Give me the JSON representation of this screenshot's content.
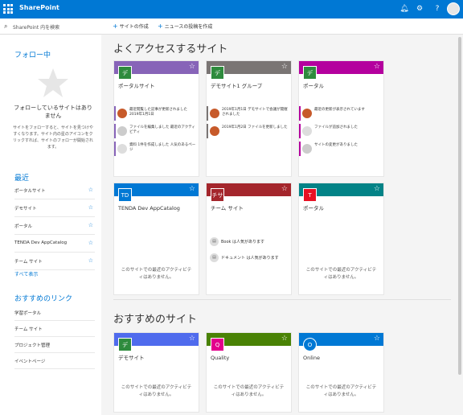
{
  "header": {
    "app_name": "SharePoint",
    "brand_color": "#0078d4",
    "icons": [
      "waffle-icon",
      "bell-icon",
      "gear-icon",
      "help-icon",
      "avatar"
    ]
  },
  "sidebar": {
    "search_placeholder": "SharePoint 内を検索",
    "following_title": "フォロー中",
    "following_message": "フォローしているサイトはありません",
    "following_help": "サイトをフォローすると、サイトを見つけやすくなります。サイト内の星のアイコンをクリックすれば、サイトのフォローが開始されます。",
    "recent_title": "最近",
    "recent_items": [
      {
        "label": "ポータルサイト"
      },
      {
        "label": "デモサイト"
      },
      {
        "label": "ポータル"
      },
      {
        "label": "TENDA Dev AppCatalog"
      },
      {
        "label": "チーム サイト"
      }
    ],
    "show_all": "すべて表示",
    "links_title": "おすすめのリンク",
    "links": [
      {
        "label": "学習ポータル"
      },
      {
        "label": "チーム サイト"
      },
      {
        "label": "プロジェクト管理"
      },
      {
        "label": "イベントページ"
      }
    ]
  },
  "commandbar": {
    "create_site": "サイトの作成",
    "create_news": "ニュースの投稿を作成"
  },
  "frequent": {
    "title": "よくアクセスするサイト",
    "cards": [
      {
        "color": "#8764b8",
        "logo_color": "#2e8b3d",
        "logo": "デ",
        "name": "ポータルサイト",
        "activities": [
          {
            "avatar": "person",
            "text": "最近閲覧した記事が更新されました 2019年1月1日"
          },
          {
            "avatar": "gray",
            "text": "ファイルを編集しました 最近のアクティビティ"
          },
          {
            "avatar": "doc",
            "text": "資料 1件を作成しました 人気のあるページ"
          }
        ]
      },
      {
        "color": "#7a7574",
        "logo_color": "#2e8b3d",
        "logo": "デ",
        "name": "デモサイト1 グループ",
        "activities": [
          {
            "avatar": "person",
            "text": "2019年1月1日 デモサイトで会議が開催されました"
          },
          {
            "avatar": "person",
            "text": "2019年1月2日 ファイルを更新しました"
          }
        ]
      },
      {
        "color": "#b4009e",
        "logo_color": "#2e8b3d",
        "logo": "デ",
        "name": "ポータル",
        "activities": [
          {
            "avatar": "person",
            "text": "最近の更新が表示されています"
          },
          {
            "avatar": "doc",
            "text": "ファイルが追加されました"
          },
          {
            "avatar": "gray",
            "text": "サイトの変更がありました"
          }
        ]
      },
      {
        "color": "#0078d4",
        "logo_color": "#0078d4",
        "logo": "TD",
        "name": "TENDA Dev AppCatalog",
        "empty": "このサイトでの最近のアクティビティはありません。"
      },
      {
        "color": "#a4262c",
        "logo_color": "#a4262c",
        "logo": "チサ",
        "name": "チーム サイト",
        "popular": [
          {
            "text": "Book は人気があります"
          },
          {
            "text": "ドキュメント は人気があります"
          }
        ]
      },
      {
        "color": "#038387",
        "logo_color": "#e81123",
        "logo": "T",
        "name": "ポータル",
        "empty": "このサイトでの最近のアクティビティはありません。"
      }
    ]
  },
  "suggested": {
    "title": "おすすめのサイト",
    "cards": [
      {
        "color": "#4f6bed",
        "logo_color": "#2e8b3d",
        "logo": "デ",
        "name": "デモサイト",
        "empty": "このサイトでの最近のアクティビティはありません。"
      },
      {
        "color": "#498205",
        "logo_color": "#e3008c",
        "logo": "Q",
        "name": "Quality",
        "empty": "このサイトでの最近のアクティビティはありません。"
      },
      {
        "color": "#0078d4",
        "logo_color": "#0078d4",
        "logo": "O",
        "name": "Online",
        "empty": "このサイトでの最近のアクティビティはありません。"
      }
    ]
  }
}
